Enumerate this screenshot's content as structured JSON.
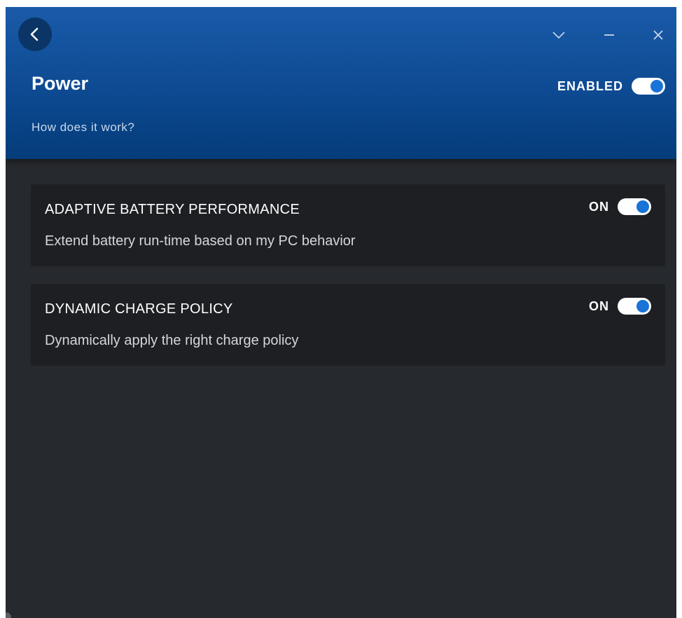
{
  "header": {
    "title": "Power",
    "link": "How does it work?",
    "enabled_label": "ENABLED",
    "enabled_state": true,
    "back_icon": "chevron-left-icon",
    "controls": [
      "chevron-down-icon",
      "minimize-icon",
      "close-icon"
    ]
  },
  "cards": [
    {
      "title": "ADAPTIVE BATTERY PERFORMANCE",
      "description": "Extend battery run-time based on my PC behavior",
      "state_label": "ON",
      "state": true
    },
    {
      "title": "DYNAMIC CHARGE POLICY",
      "description": "Dynamically apply the right charge policy",
      "state_label": "ON",
      "state": true
    }
  ],
  "colors": {
    "header_top": "#1a5aa8",
    "header_bottom": "#053c7a",
    "background": "#26292d",
    "card": "#1d1f23",
    "accent": "#1a73d6"
  }
}
